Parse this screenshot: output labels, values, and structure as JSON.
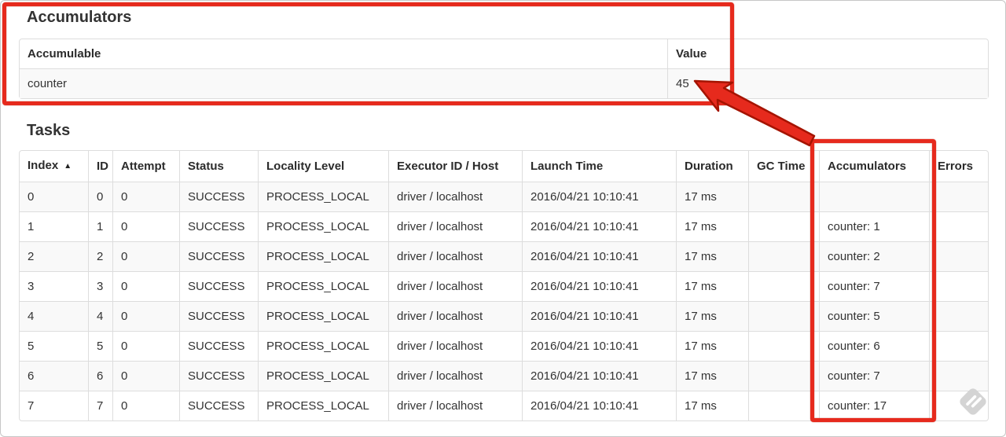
{
  "accumulators_section": {
    "title": "Accumulators",
    "table": {
      "headers": [
        "Accumulable",
        "Value"
      ],
      "rows": [
        [
          "counter",
          "45"
        ]
      ]
    }
  },
  "tasks_section": {
    "title": "Tasks",
    "table": {
      "headers": [
        "Index",
        "ID",
        "Attempt",
        "Status",
        "Locality Level",
        "Executor ID / Host",
        "Launch Time",
        "Duration",
        "GC Time",
        "Accumulators",
        "Errors"
      ],
      "sort_icon": "▲",
      "sorted_column": "Index",
      "rows": [
        [
          "0",
          "0",
          "0",
          "SUCCESS",
          "PROCESS_LOCAL",
          "driver / localhost",
          "2016/04/21 10:10:41",
          "17 ms",
          "",
          "",
          ""
        ],
        [
          "1",
          "1",
          "0",
          "SUCCESS",
          "PROCESS_LOCAL",
          "driver / localhost",
          "2016/04/21 10:10:41",
          "17 ms",
          "",
          "counter: 1",
          ""
        ],
        [
          "2",
          "2",
          "0",
          "SUCCESS",
          "PROCESS_LOCAL",
          "driver / localhost",
          "2016/04/21 10:10:41",
          "17 ms",
          "",
          "counter: 2",
          ""
        ],
        [
          "3",
          "3",
          "0",
          "SUCCESS",
          "PROCESS_LOCAL",
          "driver / localhost",
          "2016/04/21 10:10:41",
          "17 ms",
          "",
          "counter: 7",
          ""
        ],
        [
          "4",
          "4",
          "0",
          "SUCCESS",
          "PROCESS_LOCAL",
          "driver / localhost",
          "2016/04/21 10:10:41",
          "17 ms",
          "",
          "counter: 5",
          ""
        ],
        [
          "5",
          "5",
          "0",
          "SUCCESS",
          "PROCESS_LOCAL",
          "driver / localhost",
          "2016/04/21 10:10:41",
          "17 ms",
          "",
          "counter: 6",
          ""
        ],
        [
          "6",
          "6",
          "0",
          "SUCCESS",
          "PROCESS_LOCAL",
          "driver / localhost",
          "2016/04/21 10:10:41",
          "17 ms",
          "",
          "counter: 7",
          ""
        ],
        [
          "7",
          "7",
          "0",
          "SUCCESS",
          "PROCESS_LOCAL",
          "driver / localhost",
          "2016/04/21 10:10:41",
          "17 ms",
          "",
          "counter: 17",
          ""
        ]
      ]
    }
  },
  "annotations": {
    "color": "#e62a1d",
    "outline_color": "#a51300"
  },
  "colors": {
    "table_border": "#dddddd",
    "row_stripe": "#f9f9f9",
    "frame_border": "#c6c6c6",
    "watermark": "#d4d4d4"
  }
}
